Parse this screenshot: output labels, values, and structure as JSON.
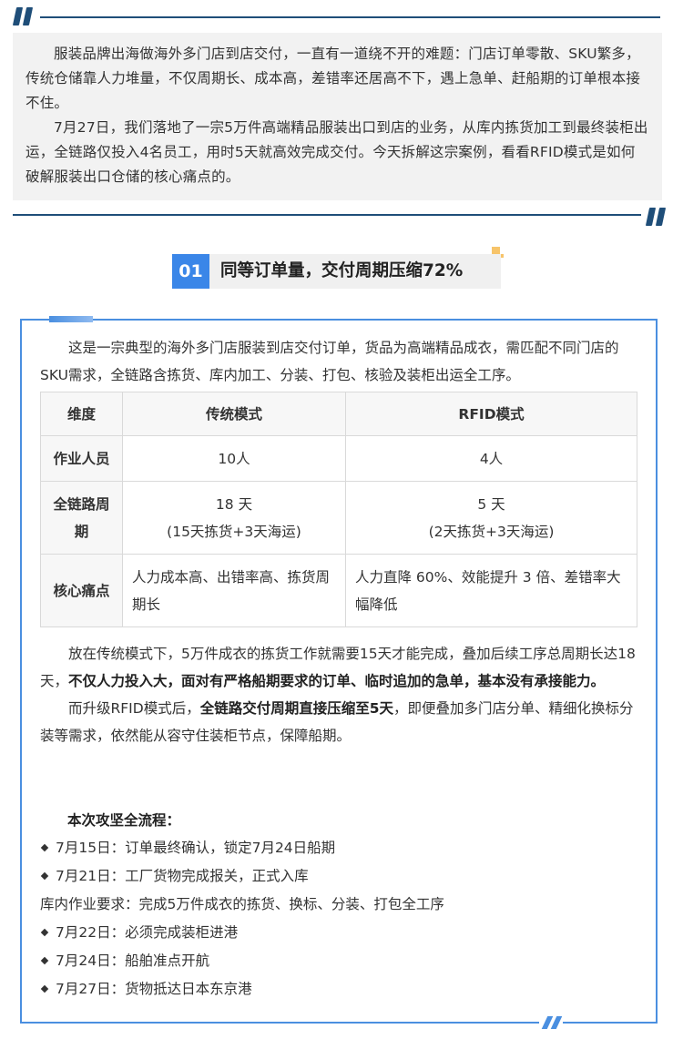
{
  "intro": {
    "paragraphs": [
      "服装品牌出海做海外多门店到店交付，一直有一道绕不开的难题：门店订单零散、SKU繁多，传统仓储靠人力堆量，不仅周期长、成本高，差错率还居高不下，遇上急单、赶船期的订单根本接不住。",
      "7月27日，我们落地了一宗5万件高端精品服装出口到店的业务，从库内拣货加工到最终装柜出运，全链路仅投入4名员工，用时5天就高效完成交付。今天拆解这宗案例，看看RFID模式是如何破解服装出口仓储的核心痛点的。"
    ]
  },
  "section": {
    "number": "01",
    "title": "同等订单量，交付周期压缩72%"
  },
  "content": {
    "intro_para": "这是一宗典型的海外多门店服装到店交付订单，货品为高端精品成衣，需匹配不同门店的SKU需求，全链路含拣货、库内加工、分装、打包、核验及装柜出运全工序。",
    "table": {
      "headers": [
        "维度",
        "传统模式",
        "RFID模式"
      ],
      "rows": [
        {
          "label": "作业人员",
          "traditional": "10人",
          "rfid": "4人"
        },
        {
          "label": "全链路周期",
          "traditional_main": "18 天",
          "traditional_sub": "(15天拣货+3天海运)",
          "rfid_main": "5 天",
          "rfid_sub": "(2天拣货+3天海运)"
        },
        {
          "label": "核心痛点",
          "traditional": "人力成本高、出错率高、拣货周期长",
          "rfid": "人力直降 60%、效能提升 3 倍、差错率大幅降低"
        }
      ]
    },
    "para2_a": "放在传统模式下，5万件成衣的拣货工作就需要15天才能完成，叠加后续工序总周期长达18天，",
    "para2_b": "不仅人力投入大，面对有严格船期要求的订单、临时追加的急单，基本没有承接能力。",
    "para3_a": "而升级RFID模式后，",
    "para3_b": "全链路交付周期直接压缩至5天",
    "para3_c": "，即便叠加多门店分单、精细化换标分装等需求，依然能从容守住装柜节点，保障船期。",
    "flow_title": "本次攻坚全流程：",
    "timeline": [
      {
        "bullet": true,
        "text": "7月15日：订单最终确认，锁定7月24日船期"
      },
      {
        "bullet": true,
        "text": "7月21日：工厂货物完成报关，正式入库"
      },
      {
        "bullet": false,
        "text": "库内作业要求：完成5万件成衣的拣货、换标、分装、打包全工序"
      },
      {
        "bullet": true,
        "text": "7月22日：必须完成装柜进港"
      },
      {
        "bullet": true,
        "text": "7月24日：船舶准点开航"
      },
      {
        "bullet": true,
        "text": "7月27日：货物抵达日本东京港"
      }
    ]
  },
  "colors": {
    "quote_navy": "#1f4e79",
    "accent_blue": "#3a86e8",
    "accent_yellow": "#f7c46a"
  }
}
